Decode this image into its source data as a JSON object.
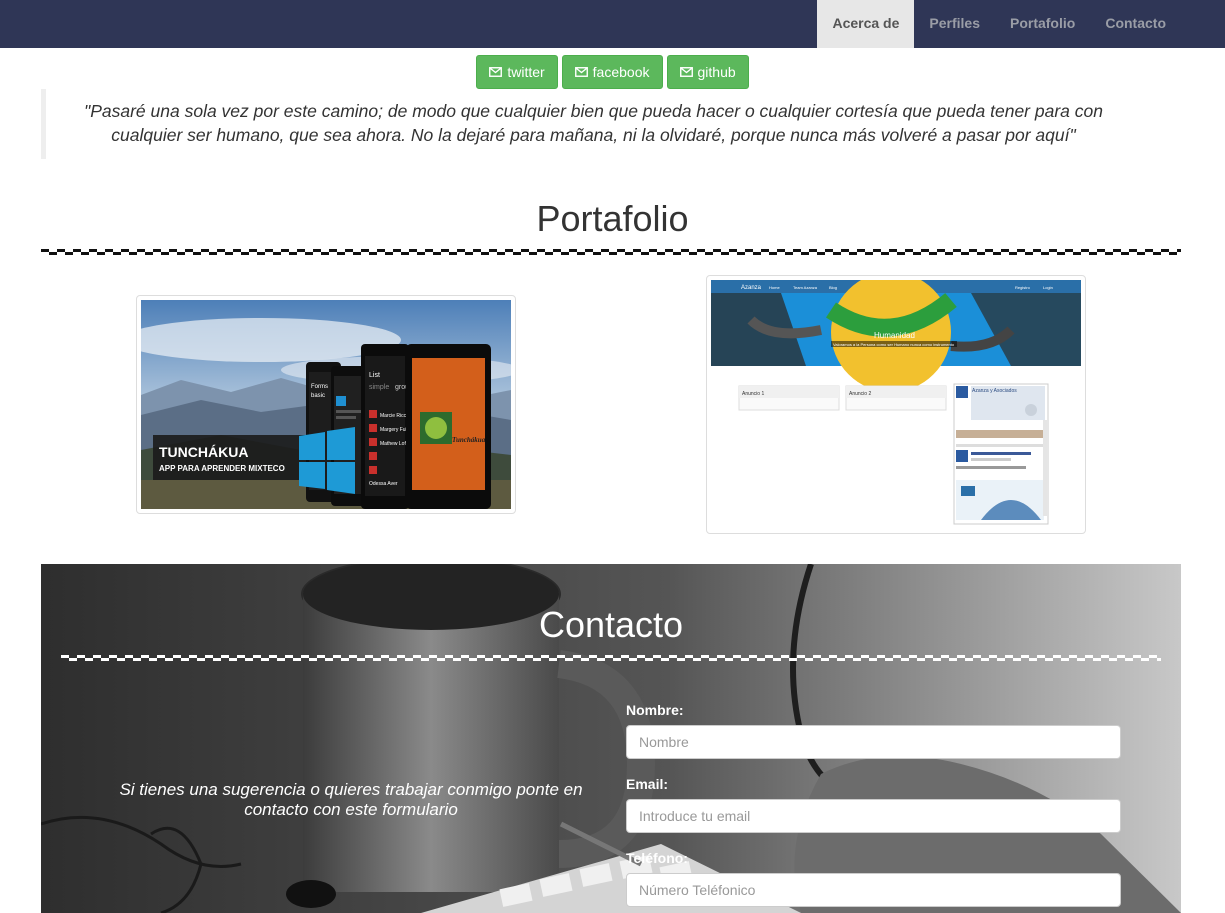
{
  "nav": {
    "items": [
      {
        "label": "Acerca de",
        "active": true
      },
      {
        "label": "Perfiles"
      },
      {
        "label": "Portafolio"
      },
      {
        "label": "Contacto"
      }
    ],
    "background": "#2f3656"
  },
  "social": {
    "buttons": [
      {
        "label": "twitter",
        "icon": "envelope-icon"
      },
      {
        "label": "facebook",
        "icon": "envelope-icon"
      },
      {
        "label": "github",
        "icon": "envelope-icon"
      }
    ],
    "color": "#5cb85c"
  },
  "quote": {
    "text": "\"Pasaré una sola vez por este camino; de modo que cualquier bien que pueda hacer o cualquier cortesía que pueda tener para con cualquier ser humano, que sea ahora. No la dejaré para mañana, ni la olvidaré, porque nunca más volveré a pasar por aquí\""
  },
  "portfolio": {
    "title": "Portafolio",
    "items": [
      {
        "title": "TUNCHÁKUA",
        "subtitle": "APP PARA APRENDER MIXTECO",
        "phone_labels": [
          "Forms",
          "basic",
          "List",
          "simple",
          "grou",
          "Marcie Ricca",
          "Margery Full",
          "Mathew Loft",
          "Odessa Aver",
          "Tunchákua"
        ]
      },
      {
        "brand": "Azanza",
        "nav": [
          "Home",
          "Team Azanza",
          "Blog",
          "Archivo",
          "Ext. Tel.",
          "Registro",
          "Login"
        ],
        "banner_title": "Humanidad",
        "banner_text": "Valoramos a la Persona como ser Humano nunca como instrumento",
        "ad_1": "Anuncio 1",
        "ad_2": "Anuncio 2",
        "fb_title": "Azanza y Asociados"
      }
    ]
  },
  "contact": {
    "title": "Contacto",
    "message": "Si tienes una sugerencia o quieres trabajar conmigo ponte en contacto con este formulario",
    "fields": [
      {
        "label": "Nombre:",
        "placeholder": "Nombre"
      },
      {
        "label": "Email:",
        "placeholder": "Introduce tu email"
      },
      {
        "label": "Teléfono:",
        "placeholder": "Número Teléfonico"
      }
    ]
  }
}
